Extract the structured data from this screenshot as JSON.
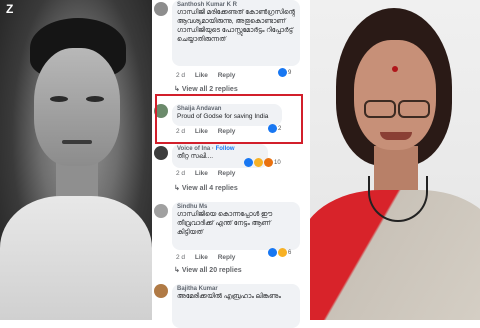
{
  "comments": [
    {
      "author": "Santhosh Kumar K R",
      "text": "ഗാന്ധിജി മരിക്കേണ്ടത് കോൺഗ്രസിൻ്റെ ആവശ്യമായിരുന്നു, അതുകൊണ്ടാണ് ഗാന്ധിജിയുടെ പോസ്റ്റുമോർട്ടം റിപ്പോർട്ട് ചെയ്യാതിരുന്നത്",
      "time": "2 d",
      "like": "Like",
      "reply": "Reply",
      "reaction_count": "9",
      "replies": "View all 2 replies"
    },
    {
      "author": "Shaija Andavan",
      "text": "Proud of Godse for saving India",
      "time": "2 d",
      "like": "Like",
      "reply": "Reply",
      "reaction_count": "2"
    },
    {
      "author": "Voice of Ina",
      "follow": "Follow",
      "text": "തീറ്റ സഖി....",
      "time": "2 d",
      "like": "Like",
      "reply": "Reply",
      "reaction_count": "10",
      "replies": "View all 4 replies"
    },
    {
      "author": "Sindhu Ms",
      "text": "ഗാന്ധിജിയെ കൊന്നപ്പോൾ ഈ തീവ്രവാദിക്ക് എന്ത് നേട്ടം ആണ് കിട്ടിയത്",
      "time": "2 d",
      "like": "Like",
      "reply": "Reply",
      "reaction_count": "6",
      "replies": "View all 20 replies"
    },
    {
      "author": "Bajitha Kumar",
      "text": "അമേരിക്കയിൽ എബ്രഹാം ലിങ്കണും"
    }
  ],
  "logo": "Z",
  "colors": {
    "highlight": "#d21f2b",
    "like_blue": "#1877f2",
    "bubble": "#f0f2f5"
  }
}
